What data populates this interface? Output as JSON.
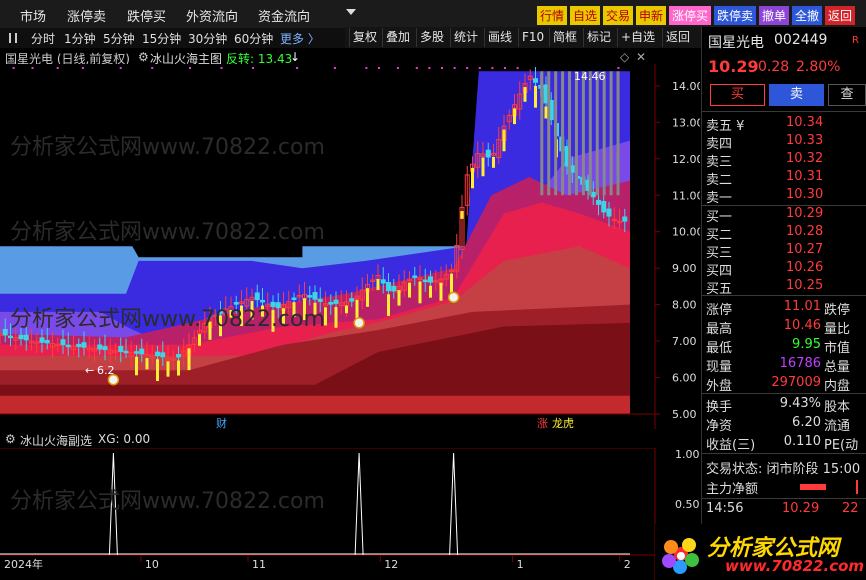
{
  "menu": [
    "市场",
    "涨停卖",
    "跌停买",
    "外资流向",
    "资金流向"
  ],
  "quick_buttons": [
    "行情",
    "自选",
    "交易",
    "申新",
    "涨停买",
    "跌停卖",
    "撤单",
    "全撤",
    "返回"
  ],
  "periods": [
    "分时",
    "1分钟",
    "5分钟",
    "15分钟",
    "30分钟",
    "60分钟",
    "更多 〉"
  ],
  "tools": [
    "复权",
    "叠加",
    "多股",
    "统计",
    "画线",
    "F10",
    "简框",
    "标记",
    "+自选",
    "返回"
  ],
  "chart": {
    "title": "国星光电 (日线,前复权)",
    "indicator": "冰山火海主图",
    "reversal": "反转: 13.43",
    "high_label": "14.46",
    "low_label": "6.2",
    "markers": [
      "财",
      "涨",
      "龙虎"
    ],
    "sub_indicator": "冰山火海副选",
    "sub_value": "XG: 0.00",
    "price_ticks": [
      "14.00",
      "13.00",
      "12.00",
      "11.00",
      "10.00",
      "9.00",
      "8.00",
      "7.00",
      "6.00",
      "5.00"
    ],
    "sub_ticks": [
      "1.00",
      "0.50"
    ],
    "date_labels": [
      "2024年",
      "10",
      "11",
      "12",
      "1",
      "2"
    ],
    "watermark": "分析家公式网www.70822.com"
  },
  "chart_data": {
    "type": "candlestick",
    "title": "国星光电 (日线,前复权)",
    "y_range": [
      5,
      14.6
    ],
    "x_months": [
      "2024年",
      "10",
      "11",
      "12",
      "1",
      "2"
    ],
    "close_path": [
      [
        0,
        7.2
      ],
      [
        5,
        7.0
      ],
      [
        10,
        6.9
      ],
      [
        15,
        6.8
      ],
      [
        20,
        6.7
      ],
      [
        25,
        6.6
      ],
      [
        28,
        6.5
      ],
      [
        30,
        6.9
      ],
      [
        33,
        7.6
      ],
      [
        36,
        7.9
      ],
      [
        40,
        8.2
      ],
      [
        44,
        7.9
      ],
      [
        48,
        8.3
      ],
      [
        52,
        8.0
      ],
      [
        56,
        8.1
      ],
      [
        58,
        8.5
      ],
      [
        60,
        8.8
      ],
      [
        62,
        8.3
      ],
      [
        64,
        8.6
      ],
      [
        66,
        8.8
      ],
      [
        68,
        8.6
      ],
      [
        70,
        8.7
      ],
      [
        72,
        9.0
      ],
      [
        74,
        11.5
      ],
      [
        76,
        12.2
      ],
      [
        78,
        12.0
      ],
      [
        80,
        12.9
      ],
      [
        82,
        13.6
      ],
      [
        84,
        14.3
      ],
      [
        86,
        13.9
      ],
      [
        88,
        12.8
      ],
      [
        90,
        11.8
      ],
      [
        92,
        11.4
      ],
      [
        94,
        11.0
      ],
      [
        96,
        10.5
      ],
      [
        98,
        10.29
      ]
    ],
    "high": 14.46,
    "low": 6.2,
    "reversal": 13.43,
    "signals_x": [
      18,
      57,
      72
    ],
    "sub_series": {
      "name": "XG",
      "value": 0.0,
      "spikes_x": [
        18,
        57,
        72
      ]
    }
  },
  "quote": {
    "name": "国星光电",
    "code": "002449",
    "price": "10.29",
    "change": "0.28",
    "pct": "2.80%",
    "buy": "买",
    "sell": "卖",
    "query": "查",
    "asks": [
      {
        "label": "卖五 ¥",
        "price": "10.34"
      },
      {
        "label": "卖四",
        "price": "10.33"
      },
      {
        "label": "卖三",
        "price": "10.32"
      },
      {
        "label": "卖二",
        "price": "10.31"
      },
      {
        "label": "卖一",
        "price": "10.30"
      }
    ],
    "bids": [
      {
        "label": "买一",
        "price": "10.29"
      },
      {
        "label": "买二",
        "price": "10.28"
      },
      {
        "label": "买三",
        "price": "10.27"
      },
      {
        "label": "买四",
        "price": "10.26"
      },
      {
        "label": "买五",
        "price": "10.25"
      }
    ],
    "stats": [
      {
        "k": "涨停",
        "v": "11.01",
        "k2": "跌停"
      },
      {
        "k": "最高",
        "v": "10.46",
        "k2": "量比"
      },
      {
        "k": "最低",
        "v": "9.95",
        "k2": "市值"
      },
      {
        "k": "现量",
        "v": "16786",
        "k2": "总量"
      },
      {
        "k": "外盘",
        "v": "297009",
        "k2": "内盘"
      }
    ],
    "stats2": [
      {
        "k": "换手",
        "v": "9.43%",
        "k2": "股本"
      },
      {
        "k": "净资",
        "v": "6.20",
        "k2": "流通"
      },
      {
        "k": "收益(三)",
        "v": "0.110",
        "k2": "PE(动"
      }
    ],
    "trade_status": "交易状态: 闭市阶段  15:00",
    "main_flow": "主力净额",
    "ticks": [
      {
        "time": "14:56",
        "price": "10.29",
        "vol": "22"
      }
    ]
  },
  "logo": {
    "text": "分析家公式网",
    "url": "www.70822.com"
  },
  "colors": {
    "up": "#ff3b3b",
    "down": "#3ad6e8",
    "yellow": "#ffee33",
    "sky": "#5a9be6",
    "purple": "#4a3ae6"
  }
}
